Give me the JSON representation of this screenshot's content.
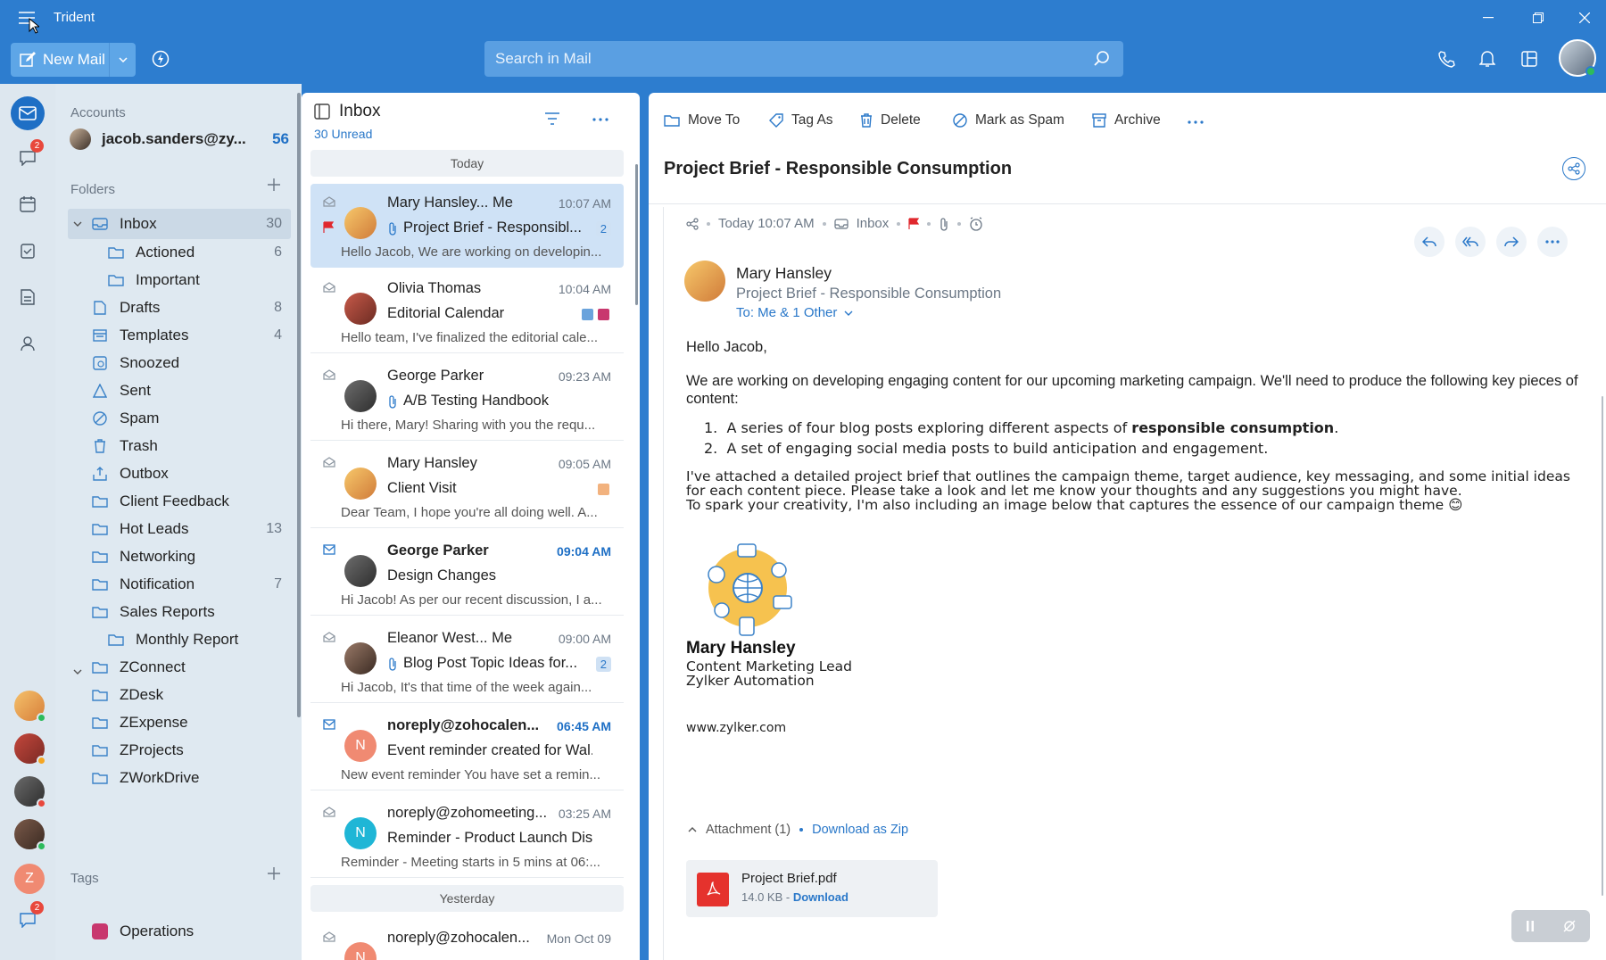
{
  "app": {
    "title": "Trident"
  },
  "toolbar": {
    "new_mail": "New Mail",
    "search_placeholder": "Search in Mail"
  },
  "rail": {
    "chat_badge": "2",
    "bottom_badge": "2",
    "avatar_letter": "Z"
  },
  "folders": {
    "accounts_label": "Accounts",
    "account": {
      "email": "jacob.sanders@zy...",
      "count": "56"
    },
    "folders_label": "Folders",
    "tags_label": "Tags",
    "items": [
      {
        "label": "Inbox",
        "count": "30"
      },
      {
        "label": "Actioned",
        "count": "6"
      },
      {
        "label": "Important",
        "count": ""
      },
      {
        "label": "Drafts",
        "count": "8"
      },
      {
        "label": "Templates",
        "count": "4"
      },
      {
        "label": "Snoozed",
        "count": ""
      },
      {
        "label": "Sent",
        "count": ""
      },
      {
        "label": "Spam",
        "count": ""
      },
      {
        "label": "Trash",
        "count": ""
      },
      {
        "label": "Outbox",
        "count": ""
      },
      {
        "label": "Client Feedback",
        "count": ""
      },
      {
        "label": "Hot Leads",
        "count": "13"
      },
      {
        "label": "Networking",
        "count": ""
      },
      {
        "label": "Notification",
        "count": "7"
      },
      {
        "label": "Sales Reports",
        "count": ""
      },
      {
        "label": "Monthly Report",
        "count": ""
      },
      {
        "label": "ZConnect",
        "count": ""
      },
      {
        "label": "ZDesk",
        "count": ""
      },
      {
        "label": "ZExpense",
        "count": ""
      },
      {
        "label": "ZProjects",
        "count": ""
      },
      {
        "label": "ZWorkDrive",
        "count": ""
      }
    ],
    "tag": {
      "label": "Operations",
      "color": "#c8376e"
    }
  },
  "list": {
    "title": "Inbox",
    "unread": "30 Unread",
    "today": "Today",
    "yesterday": "Yesterday",
    "mails": [
      {
        "from": "Mary Hansley... Me",
        "time": "10:07 AM",
        "subject": "Project Brief - Responsibl...",
        "preview": "Hello Jacob, We are working on developin...",
        "count": "2"
      },
      {
        "from": "Olivia Thomas",
        "time": "10:04 AM",
        "subject": "Editorial Calendar",
        "preview": "Hello team, I've finalized the editorial cale..."
      },
      {
        "from": "George Parker",
        "time": "09:23 AM",
        "subject": "A/B Testing Handbook",
        "preview": "Hi there, Mary! Sharing with you the requ..."
      },
      {
        "from": "Mary Hansley",
        "time": "09:05 AM",
        "subject": "Client Visit",
        "preview": "Dear Team, I hope you're all doing well. A..."
      },
      {
        "from": "George Parker",
        "time": "09:04 AM",
        "subject": "Design Changes",
        "preview": "Hi Jacob! As per our recent discussion, I a..."
      },
      {
        "from": "Eleanor West... Me",
        "time": "09:00 AM",
        "subject": "Blog Post Topic Ideas for...",
        "preview": "Hi Jacob, It's that time of the week again...",
        "count": "2"
      },
      {
        "from": "noreply@zohocalen...",
        "time": "06:45 AM",
        "subject": "Event reminder created for Wal...",
        "preview": "New event reminder You have set a remin...",
        "avatar": "N"
      },
      {
        "from": "noreply@zohomeeting...",
        "time": "03:25 AM",
        "subject": "Reminder - Product Launch Dis...",
        "preview": "Reminder - Meeting starts in 5 mins at 06:...",
        "avatar": "N"
      },
      {
        "from": "noreply@zohocalen...",
        "time": "Mon Oct 09",
        "avatar": "N"
      }
    ]
  },
  "reading": {
    "actions": {
      "move": "Move To",
      "tag": "Tag As",
      "delete": "Delete",
      "spam": "Mark as Spam",
      "archive": "Archive"
    },
    "subject": "Project Brief - Responsible Consumption",
    "meta": {
      "time": "Today 10:07 AM",
      "folder": "Inbox"
    },
    "sender": "Mary Hansley",
    "sender_subject": "Project Brief - Responsible Consumption",
    "to": "To: Me & 1 Other",
    "greeting": "Hello Jacob,",
    "para1": "We are working on developing engaging content for our upcoming marketing campaign. We'll need to produce the following key pieces of content:",
    "li1_a": "A series of four blog posts exploring different aspects of ",
    "li1_b": "responsible consumption",
    "li1_c": ".",
    "li2": "A set of engaging social media posts to build anticipation and engagement.",
    "para2": "I've attached a detailed project brief that outlines the campaign theme, target audience, key messaging, and some initial ideas for each content piece. Please take a look and let me know your thoughts and any suggestions you might have.",
    "para3": "To spark your creativity, I'm also including an image below that captures the essence of our campaign theme 😊",
    "sig_name": "Mary Hansley",
    "sig_title": "Content Marketing Lead",
    "sig_company": "Zylker Automation",
    "sig_web": "www.zylker.com",
    "attachment_label": "Attachment (1)",
    "download_zip": "Download as Zip",
    "file_name": "Project Brief.pdf",
    "file_size": "14.0 KB - ",
    "file_download": "Download"
  }
}
